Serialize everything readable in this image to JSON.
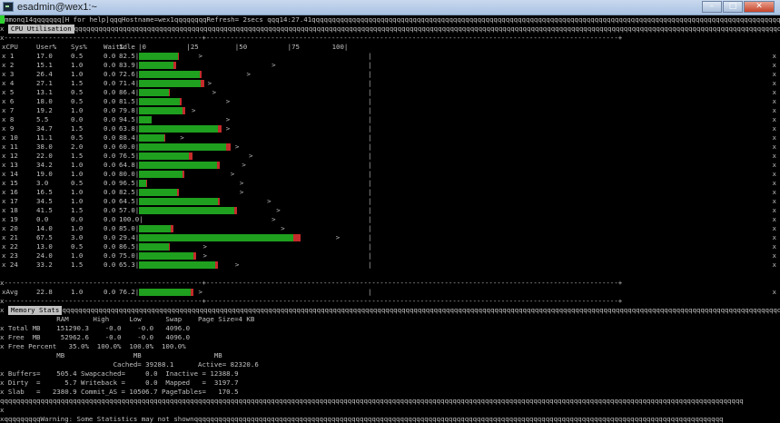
{
  "window": {
    "title": "esadmin@wex1:~"
  },
  "status_line": "mmonq14qqqqqqq[H for help]qqqHostname=wex1qqqqqqqqRefresh= 2secs qqq14:27.41",
  "cpu_section": {
    "title": "CPU Utilisation",
    "header": {
      "cpu": "xCPU",
      "user": "User%",
      "sys": "Sys%",
      "wait": "Wait%",
      "idle": "Idle",
      "scale": "|0          |25         |50          |75        100|"
    },
    "rows": [
      {
        "cpu": "1",
        "user": 17.0,
        "sys": 0.5,
        "wait": 0.0,
        "idle": "82.5",
        "peak": 26
      },
      {
        "cpu": "2",
        "user": 15.1,
        "sys": 1.0,
        "wait": 0.0,
        "idle": "83.9",
        "peak": 58
      },
      {
        "cpu": "3",
        "user": 26.4,
        "sys": 1.0,
        "wait": 0.0,
        "idle": "72.6",
        "peak": 47
      },
      {
        "cpu": "4",
        "user": 27.1,
        "sys": 1.5,
        "wait": 0.0,
        "idle": "71.4",
        "peak": 30
      },
      {
        "cpu": "5",
        "user": 13.1,
        "sys": 0.5,
        "wait": 0.0,
        "idle": "86.4",
        "peak": 32
      },
      {
        "cpu": "6",
        "user": 18.0,
        "sys": 0.5,
        "wait": 0.0,
        "idle": "81.5",
        "peak": 38
      },
      {
        "cpu": "7",
        "user": 19.2,
        "sys": 1.0,
        "wait": 0.0,
        "idle": "79.8",
        "peak": 23
      },
      {
        "cpu": "8",
        "user": 5.5,
        "sys": 0.0,
        "wait": 0.0,
        "idle": "94.5",
        "peak": 38
      },
      {
        "cpu": "9",
        "user": 34.7,
        "sys": 1.5,
        "wait": 0.0,
        "idle": "63.8",
        "peak": 38
      },
      {
        "cpu": "10",
        "user": 11.1,
        "sys": 0.5,
        "wait": 0.0,
        "idle": "88.4",
        "peak": 18
      },
      {
        "cpu": "11",
        "user": 38.0,
        "sys": 2.0,
        "wait": 0.0,
        "idle": "60.0",
        "peak": 42
      },
      {
        "cpu": "12",
        "user": 22.0,
        "sys": 1.5,
        "wait": 0.0,
        "idle": "76.5",
        "peak": 48
      },
      {
        "cpu": "13",
        "user": 34.2,
        "sys": 1.0,
        "wait": 0.0,
        "idle": "64.8",
        "peak": 45
      },
      {
        "cpu": "14",
        "user": 19.0,
        "sys": 1.0,
        "wait": 0.0,
        "idle": "80.0",
        "peak": 40
      },
      {
        "cpu": "15",
        "user": 3.0,
        "sys": 0.5,
        "wait": 0.0,
        "idle": "96.5",
        "peak": 44
      },
      {
        "cpu": "16",
        "user": 16.5,
        "sys": 1.0,
        "wait": 0.0,
        "idle": "82.5",
        "peak": 44
      },
      {
        "cpu": "17",
        "user": 34.5,
        "sys": 1.0,
        "wait": 0.0,
        "idle": "64.5",
        "peak": 56
      },
      {
        "cpu": "18",
        "user": 41.5,
        "sys": 1.5,
        "wait": 0.0,
        "idle": "57.0",
        "peak": 60
      },
      {
        "cpu": "19",
        "user": 0.0,
        "sys": 0.0,
        "wait": 0.0,
        "idle": "100.0",
        "peak": 58
      },
      {
        "cpu": "20",
        "user": 14.0,
        "sys": 1.0,
        "wait": 0.0,
        "idle": "85.0",
        "peak": 62
      },
      {
        "cpu": "21",
        "user": 67.5,
        "sys": 3.0,
        "wait": 0.0,
        "idle": "29.4",
        "peak": 86
      },
      {
        "cpu": "22",
        "user": 13.0,
        "sys": 0.5,
        "wait": 0.0,
        "idle": "86.5",
        "peak": 28
      },
      {
        "cpu": "23",
        "user": 24.0,
        "sys": 1.0,
        "wait": 0.0,
        "idle": "75.0",
        "peak": 28
      },
      {
        "cpu": "24",
        "user": 33.2,
        "sys": 1.5,
        "wait": 0.0,
        "idle": "65.3",
        "peak": 42
      }
    ],
    "avg": {
      "cpu": "xAvg",
      "user": 22.8,
      "sys": 1.0,
      "wait": 0.0,
      "idle": "76.2",
      "peak": 26
    }
  },
  "memory_section": {
    "title": "Memory Stats",
    "lines": [
      "              RAM      High     Low      Swap    Page Size=4 KB",
      "x Total MB    151290.3    -0.0    -0.0   4096.0",
      "x Free  MB     52962.6    -0.0    -0.0   4096.0",
      "x Free Percent   35.0%  100.0%  100.0%  100.0%",
      "              MB                 MB                  MB",
      "                            Cached= 39288.1      Active= 82320.6",
      "x Buffers=    505.4 Swapcached=     0.0  Inactive = 12388.9",
      "x Dirty  =      5.7 Writeback =     0.0  Mapped   =  3197.7",
      "x Slab   =   2380.9 Commit_AS = 10506.7 PageTables=   170.5"
    ]
  },
  "bottom_line": "xqqqqqqqqqWarning: Some Statistics may not shownqqqqqqqqqqqqqqqqqqqqqqqqqqqqqqqqqqqqqqqqqqqqqqqqqqqqqqqqqqqqqqqqqqqqqqqqqqqqqqqqqqqqqqqqqqqqqqqqqqqqqqqqqqqqqqqqqqqqqqqqqqqqqqqqqqq",
  "glyphs": {
    "q_run": "qqqqqqqqqqqqqqqqqqqqqqqqqqqqqqqqqqqqqqqqqqqqqqqqqqqqqqqqqqqqqqqqqqqqqqqqqqqqqqqqqqqqqqqqqqqqqqqqqqqqqqqqqqqqqqqqqqqqqqqqqqqqqqqqqqqqqqqqqqqqqqqqqqqqqqqqqqqqqqqqqqqqqqqqqqqqqqqqqqqqqqqq",
    "dash_run": "x-------------------------------------------------+------------------------------------------------------------------------------------------------------+",
    "side": "x",
    "bar_char": "U",
    "peak_char": ">"
  },
  "colors": {
    "user": "#2fcf2f",
    "sys": "#d23a3a",
    "wait": "#4a6ad6",
    "bar_user": "#1fa01f",
    "bar_sys": "#c42b2b"
  }
}
